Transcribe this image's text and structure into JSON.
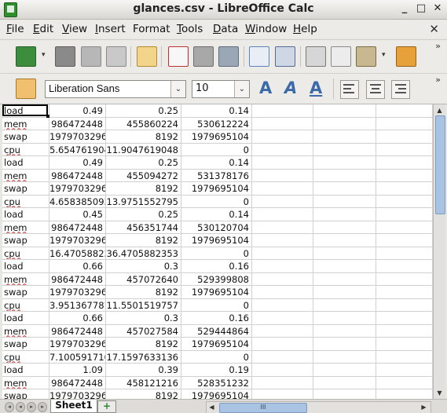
{
  "window": {
    "title": "glances.csv - LibreOffice Calc",
    "minimize": "_",
    "maximize": "□",
    "close": "✕"
  },
  "menubar": {
    "items": [
      {
        "underline": "F",
        "rest": "ile"
      },
      {
        "underline": "E",
        "rest": "dit"
      },
      {
        "underline": "V",
        "rest": "iew"
      },
      {
        "underline": "I",
        "rest": "nsert"
      },
      {
        "underline": "",
        "rest": "Format"
      },
      {
        "underline": "T",
        "rest": "ools"
      },
      {
        "underline": "D",
        "rest": "ata"
      },
      {
        "underline": "W",
        "rest": "indow"
      },
      {
        "underline": "H",
        "rest": "elp"
      }
    ],
    "close": "✕"
  },
  "toolbar": {
    "more": "»",
    "font_name": "Liberation Sans",
    "font_size": "10",
    "bold_letter": "A",
    "italic_letter": "A",
    "underline_letter": "A",
    "dropdown": "⌄"
  },
  "sheet": {
    "rows": [
      [
        "load",
        "0.49",
        "0.25",
        "0.14"
      ],
      [
        "mem",
        "986472448",
        "455860224",
        "530612224"
      ],
      [
        "swap",
        "1979703296",
        "8192",
        "1979695104"
      ],
      [
        "cpu",
        "5.6547619048",
        "11.9047619048",
        "0"
      ],
      [
        "load",
        "0.49",
        "0.25",
        "0.14"
      ],
      [
        "mem",
        "986472448",
        "455094272",
        "531378176"
      ],
      [
        "swap",
        "1979703296",
        "8192",
        "1979695104"
      ],
      [
        "cpu",
        "4.6583850932",
        "13.9751552795",
        "0"
      ],
      [
        "load",
        "0.45",
        "0.25",
        "0.14"
      ],
      [
        "mem",
        "986472448",
        "456351744",
        "530120704"
      ],
      [
        "swap",
        "1979703296",
        "8192",
        "1979695104"
      ],
      [
        "cpu",
        "16.4705882353",
        "36.4705882353",
        "0"
      ],
      [
        "load",
        "0.66",
        "0.3",
        "0.16"
      ],
      [
        "mem",
        "986472448",
        "457072640",
        "529399808"
      ],
      [
        "swap",
        "1979703296",
        "8192",
        "1979695104"
      ],
      [
        "cpu",
        "3.9513677812",
        "11.5501519757",
        "0"
      ],
      [
        "load",
        "0.66",
        "0.3",
        "0.16"
      ],
      [
        "mem",
        "986472448",
        "457027584",
        "529444864"
      ],
      [
        "swap",
        "1979703296",
        "8192",
        "1979695104"
      ],
      [
        "cpu",
        "7.100591716",
        "17.1597633136",
        "0"
      ],
      [
        "load",
        "1.09",
        "0.39",
        "0.19"
      ],
      [
        "mem",
        "986472448",
        "458121216",
        "528351232"
      ],
      [
        "swap",
        "1979703296",
        "8192",
        "1979695104"
      ]
    ]
  },
  "bottom": {
    "sheet_tab": "Sheet1",
    "add_tab": "+",
    "scroll_grip": "III"
  }
}
